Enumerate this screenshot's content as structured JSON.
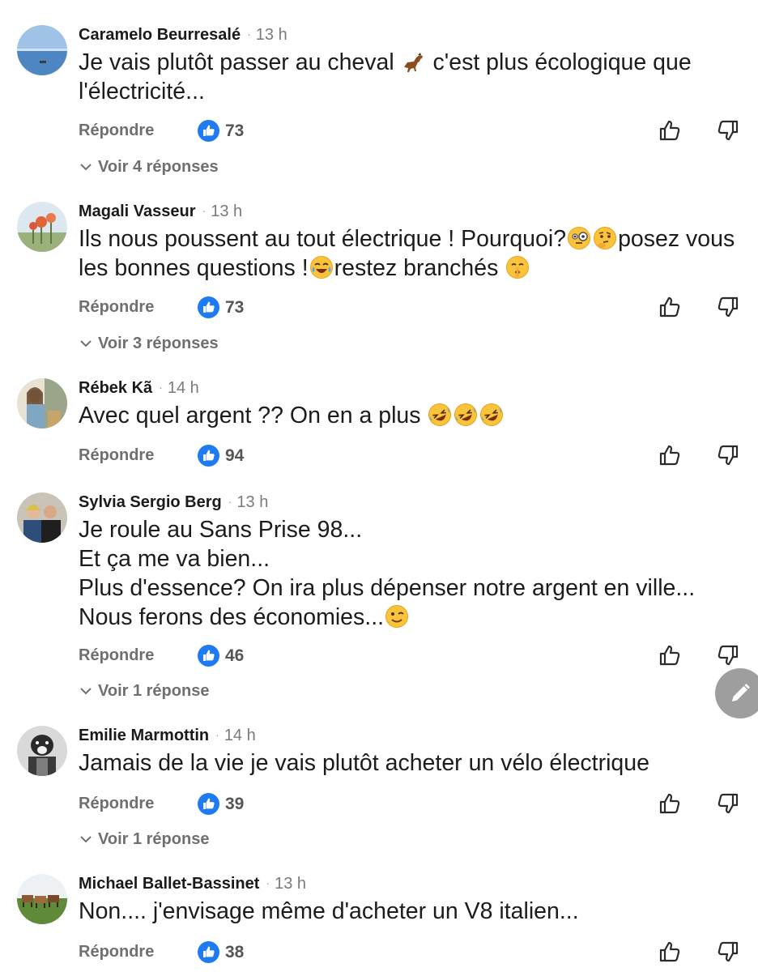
{
  "labels": {
    "reply": "Répondre",
    "separator": "·"
  },
  "comments": [
    {
      "author": "Caramelo Beurresalé",
      "time": "13 h",
      "text_parts": [
        "Je vais plutôt passer au cheval ",
        " c'est plus écologique que l'électricité..."
      ],
      "emojis": [
        "horse-emoji"
      ],
      "likes": "73",
      "replies": "Voir 4 réponses"
    },
    {
      "author": "Magali Vasseur",
      "time": "13 h",
      "text_parts": [
        "Ils nous poussent au tout électrique ! Pourquoi?",
        "posez vous les bonnes questions !",
        "restez branchés "
      ],
      "emojis": [
        "face-with-monocle-emoji",
        "thinking-face-emoji",
        "tears-of-joy-emoji",
        "shushing-face-emoji"
      ],
      "likes": "73",
      "replies": "Voir 3 réponses"
    },
    {
      "author": "Rébek Kã",
      "time": "14 h",
      "text_parts": [
        "Avec quel argent ?? On en a plus "
      ],
      "emojis": [
        "rolling-laughing-emoji",
        "rolling-laughing-emoji",
        "rolling-laughing-emoji"
      ],
      "likes": "94",
      "replies": ""
    },
    {
      "author": "Sylvia Sergio Berg",
      "time": "13 h",
      "text_parts": [
        "Je roule au Sans Prise 98...\nEt ça me va bien...\nPlus d'essence? On ira plus dépenser notre argent en ville...\nNous ferons des économies..."
      ],
      "emojis": [
        "winking-face-emoji"
      ],
      "likes": "46",
      "replies": "Voir 1 réponse"
    },
    {
      "author": "Emilie Marmottin",
      "time": "14 h",
      "text_parts": [
        "Jamais de la vie je vais plutôt acheter un vélo électrique"
      ],
      "emojis": [],
      "likes": "39",
      "replies": "Voir 1 réponse"
    },
    {
      "author": "Michael Ballet-Bassinet",
      "time": "13 h",
      "text_parts": [
        "Non.... j'envisage même d'acheter un V8 italien..."
      ],
      "emojis": [],
      "likes": "38",
      "replies": ""
    }
  ],
  "colors": {
    "like_badge": "#1f7bf2",
    "meta_text": "#6f6f6f",
    "fab": "#9e9e9e"
  },
  "icons": [
    "thumbs-up-outline-icon",
    "thumbs-down-outline-icon",
    "chevron-down-icon",
    "pencil-icon"
  ]
}
